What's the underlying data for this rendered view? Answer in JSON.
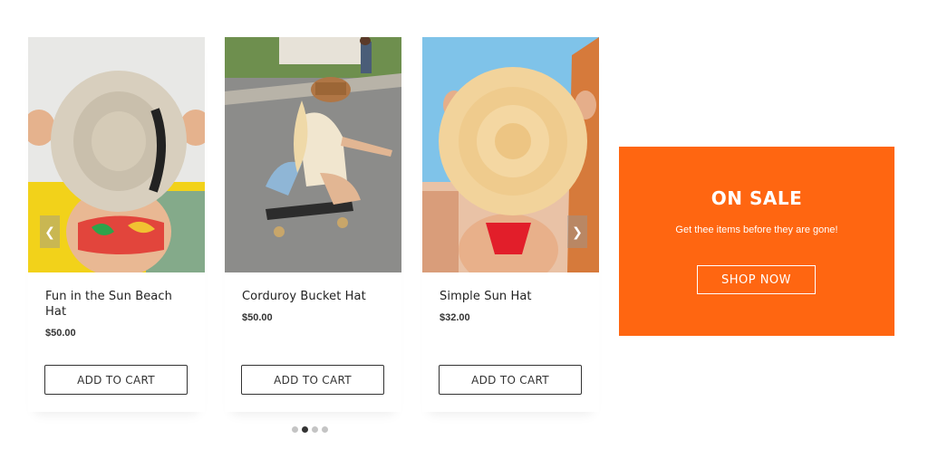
{
  "products": [
    {
      "title": "Fun in the Sun Beach Hat",
      "price": "$50.00",
      "button": "ADD TO CART",
      "image": "beach-hat-photo"
    },
    {
      "title": "Corduroy Bucket Hat",
      "price": "$50.00",
      "button": "ADD TO CART",
      "image": "skateboarder-photo"
    },
    {
      "title": "Simple Sun Hat",
      "price": "$32.00",
      "button": "ADD TO CART",
      "image": "sun-hat-photo"
    }
  ],
  "carousel": {
    "prev_icon": "chevron-left-icon",
    "next_icon": "chevron-right-icon",
    "dot_count": 4,
    "active_dot": 2
  },
  "sale": {
    "title": "ON SALE",
    "subtitle": "Get thee items before they are gone!",
    "button": "SHOP NOW",
    "color": "#ff6611"
  }
}
